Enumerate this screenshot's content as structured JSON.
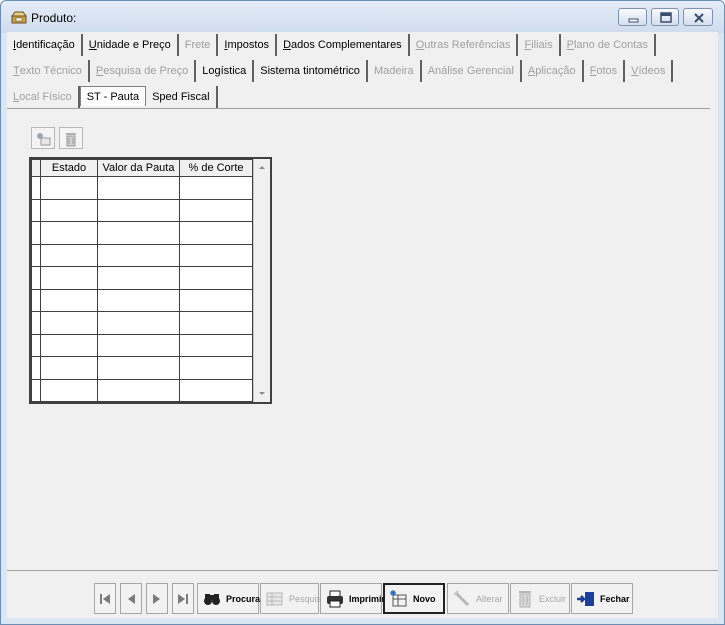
{
  "window": {
    "title": "Produto:"
  },
  "tabs_row1": [
    {
      "label": "Identificação",
      "u": "I",
      "rest": "dentificação",
      "enabled": true
    },
    {
      "label": "Unidade e Preço",
      "u": "U",
      "rest": "nidade e Preço",
      "enabled": true
    },
    {
      "label": "Frete",
      "u": "",
      "rest": "Frete",
      "enabled": false
    },
    {
      "label": "Impostos",
      "u": "I",
      "rest": "mpostos",
      "enabled": true
    },
    {
      "label": "Dados Complementares",
      "u": "D",
      "rest": "ados Complementares",
      "enabled": true
    },
    {
      "label": "Outras Referências",
      "u": "O",
      "rest": "utras Referências",
      "enabled": false
    },
    {
      "label": "Filiais",
      "u": "F",
      "rest": "iliais",
      "enabled": false
    },
    {
      "label": "Plano de Contas",
      "u": "P",
      "rest": "lano de Contas",
      "enabled": false
    }
  ],
  "tabs_row2": [
    {
      "label": "Texto Técnico",
      "u": "T",
      "rest": "exto Técnico",
      "enabled": false
    },
    {
      "label": "Pesquisa de Preço",
      "u": "P",
      "rest": "esquisa de Preço",
      "enabled": false
    },
    {
      "label": "Logística",
      "u": "",
      "rest": "Logística",
      "enabled": true
    },
    {
      "label": "Sistema tintométrico",
      "u": "",
      "rest": "Sistema tintométrico",
      "enabled": true
    },
    {
      "label": "Madeira",
      "u": "",
      "rest": "Madeira",
      "enabled": false
    },
    {
      "label": "Análise Gerencial",
      "u": "",
      "rest": "Análise Gerencial",
      "enabled": false
    },
    {
      "label": "Aplicação",
      "u": "A",
      "rest": "plicação",
      "enabled": false
    },
    {
      "label": "Fotos",
      "u": "F",
      "rest": "otos",
      "enabled": false
    },
    {
      "label": "Vídeos",
      "u": "V",
      "rest": "ídeos",
      "enabled": false
    }
  ],
  "tabs_row3": [
    {
      "label": "Local Físico",
      "u": "L",
      "rest": "ocal Físico",
      "enabled": false
    },
    {
      "label": "ST - Pauta",
      "u": "",
      "rest": "ST - Pauta",
      "enabled": true,
      "active": true
    },
    {
      "label": "Sped Fiscal",
      "u": "",
      "rest": "Sped Fiscal",
      "enabled": true
    }
  ],
  "grid": {
    "columns": [
      "Estado",
      "Valor da Pauta",
      "% de Corte"
    ],
    "row_count": 10
  },
  "toolbar": {
    "procurar": "Procurar",
    "pesquisa": "Pesquisa",
    "imprimir": "Imprimir",
    "novo": "Novo",
    "alterar": "Alterar",
    "excluir": "Excluir",
    "fechar": "Fechar"
  }
}
